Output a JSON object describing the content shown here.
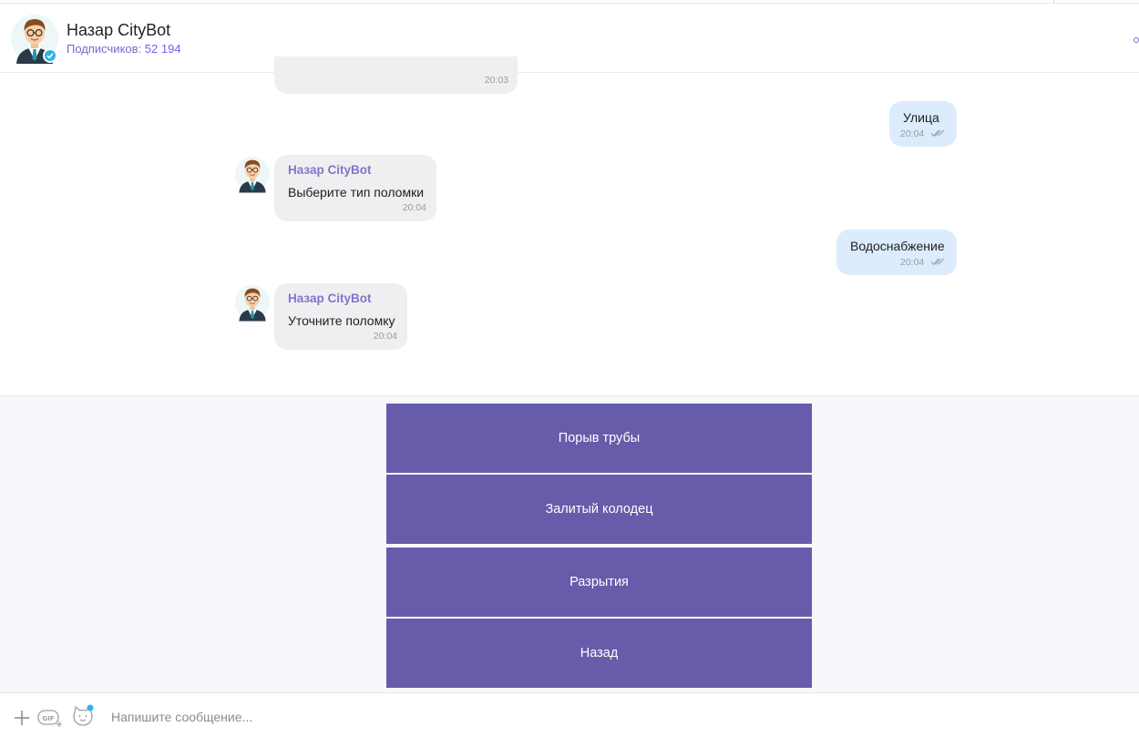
{
  "header": {
    "bot_name": "Назар CityBot",
    "subscribers_label": "Подписчиков:",
    "subscribers_count": "52 194"
  },
  "messages": [
    {
      "direction": "incoming",
      "sender": "",
      "text": "",
      "time": "20:03"
    },
    {
      "direction": "outgoing",
      "text": "Улица",
      "time": "20:04",
      "status": "read"
    },
    {
      "direction": "incoming",
      "sender": "Назар CityBot",
      "text": "Выберите тип поломки",
      "time": "20:04"
    },
    {
      "direction": "outgoing",
      "text": "Водоснабжение",
      "time": "20:04",
      "status": "read"
    },
    {
      "direction": "incoming",
      "sender": "Назар CityBot",
      "text": "Уточните поломку",
      "time": "20:04"
    }
  ],
  "keyboard": {
    "buttons": [
      {
        "label": "Порыв трубы"
      },
      {
        "label": "Залитый колодец"
      },
      {
        "label": "Разрытия"
      },
      {
        "label": "Назад"
      }
    ]
  },
  "composer": {
    "placeholder": "Напишите сообщение...",
    "gif_label": "GIF"
  },
  "colors": {
    "accent": "#7360f2",
    "keyboard_button": "#665ca9",
    "incoming_bubble": "#efeff1",
    "outgoing_bubble": "#dcecfc",
    "verified": "#2cb3e6"
  },
  "icons": {
    "header_avatar": "businessman-avatar",
    "verified": "verified-check-icon",
    "read_status": "double-check-icon",
    "attach": "plus-icon",
    "gif": "gif-icon",
    "sticker": "sticker-cat-icon"
  }
}
